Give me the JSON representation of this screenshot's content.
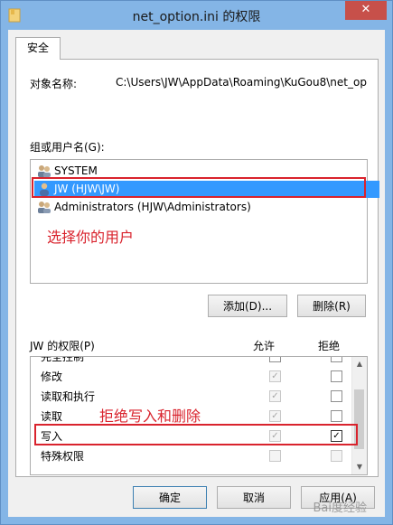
{
  "window": {
    "title": "net_option.ini 的权限",
    "close_glyph": "✕"
  },
  "tab": {
    "label": "安全"
  },
  "object": {
    "label": "对象名称:",
    "path": "C:\\Users\\JW\\AppData\\Roaming\\KuGou8\\net_op"
  },
  "users": {
    "label": "组或用户名(G):",
    "items": [
      {
        "name": "SYSTEM",
        "icon": "group-icon",
        "selected": false
      },
      {
        "name": "JW (HJW\\JW)",
        "icon": "user-icon",
        "selected": true
      },
      {
        "name": "Administrators (HJW\\Administrators)",
        "icon": "group-icon",
        "selected": false
      }
    ],
    "annotation": "选择你的用户"
  },
  "buttons": {
    "add": "添加(D)...",
    "remove": "删除(R)"
  },
  "permissions": {
    "label": "JW 的权限(P)",
    "allow_header": "允许",
    "deny_header": "拒绝",
    "annotation": "拒绝写入和删除",
    "rows": [
      {
        "name": "完全控制",
        "allow": false,
        "deny": false
      },
      {
        "name": "修改",
        "allow": true,
        "deny": false
      },
      {
        "name": "读取和执行",
        "allow": true,
        "deny": false
      },
      {
        "name": "读取",
        "allow": true,
        "deny": false
      },
      {
        "name": "写入",
        "allow": true,
        "deny": true
      },
      {
        "name": "特殊权限",
        "allow": false,
        "deny": false
      }
    ]
  },
  "footer": {
    "ok": "确定",
    "cancel": "取消",
    "apply": "应用(A)"
  },
  "watermark": "Bai度经验",
  "colors": {
    "selection": "#3399ff",
    "annotation": "#d9232d",
    "close": "#c7504a"
  }
}
